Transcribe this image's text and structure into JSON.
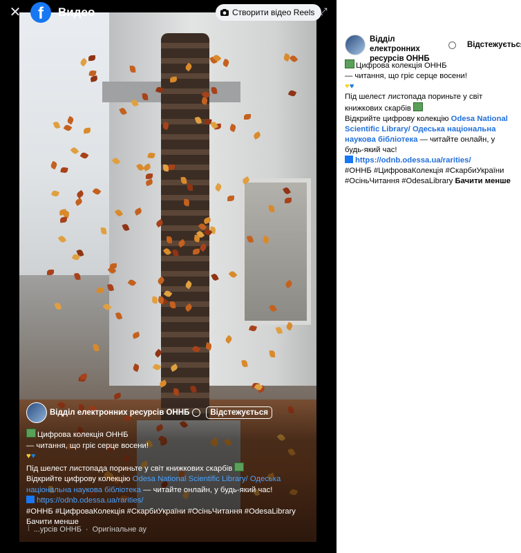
{
  "topbar": {
    "close_icon": "close-icon",
    "logo_letter": "f",
    "title": "Видео",
    "reels_button": "Створити відео Reels",
    "expand_icon": "expand-icon"
  },
  "video_overlay": {
    "author_name": "Відділ електронних ресурсів ОННБ",
    "follow_label": "Відстежується",
    "line1": "Цифрова колекція ОННБ",
    "line2": "— читання, що гріє серце восени!",
    "line4": "Під шелест листопада пориньте у світ книжкових скарбів",
    "line5_prefix": "Відкрийте цифрову колекцію ",
    "line5_link": "Odesa National Scientific Library/ Одеська національна наукова бібліотека",
    "line5_suffix": " — читайте онлайн, у будь-який час!",
    "url": "https://odnb.odessa.ua/rarities/",
    "hashtags": "#ОННБ #ЦифроваКолекція #СкарбиУкраїни #ОсіньЧитання #OdesaLibrary",
    "see_less": "Бачити менше",
    "footer_author": "...урсів ОННБ",
    "footer_audio": "Оригінальне ау"
  },
  "sidebar": {
    "author_name": "Відділ електронних ресурсів ОННБ",
    "follow_label": "Відстежується",
    "line1": "Цифрова колекція ОННБ",
    "line2": "— читання, що гріє серце восени!",
    "line4": "Під шелест листопада пориньте у світ книжкових скарбів",
    "line5_prefix": "Відкрийте цифрову колекцію ",
    "line5_link": "Odesa National Scientific Library/ Одеська національна наукова бібліотека",
    "line5_suffix": " — читайте онлайн, у будь-який час!",
    "url": "https://odnb.odessa.ua/rarities/",
    "hashtags": "#ОННБ #ЦифроваКолекція #СкарбиУкраїни #ОсіньЧитання #OdesaLibrary",
    "see_less": "Бачити менше"
  },
  "colors": {
    "facebook_blue": "#1877f2",
    "link_blue": "#216fdb",
    "heart_yellow": "#f7d131",
    "heart_blue": "#1f7bd8"
  }
}
